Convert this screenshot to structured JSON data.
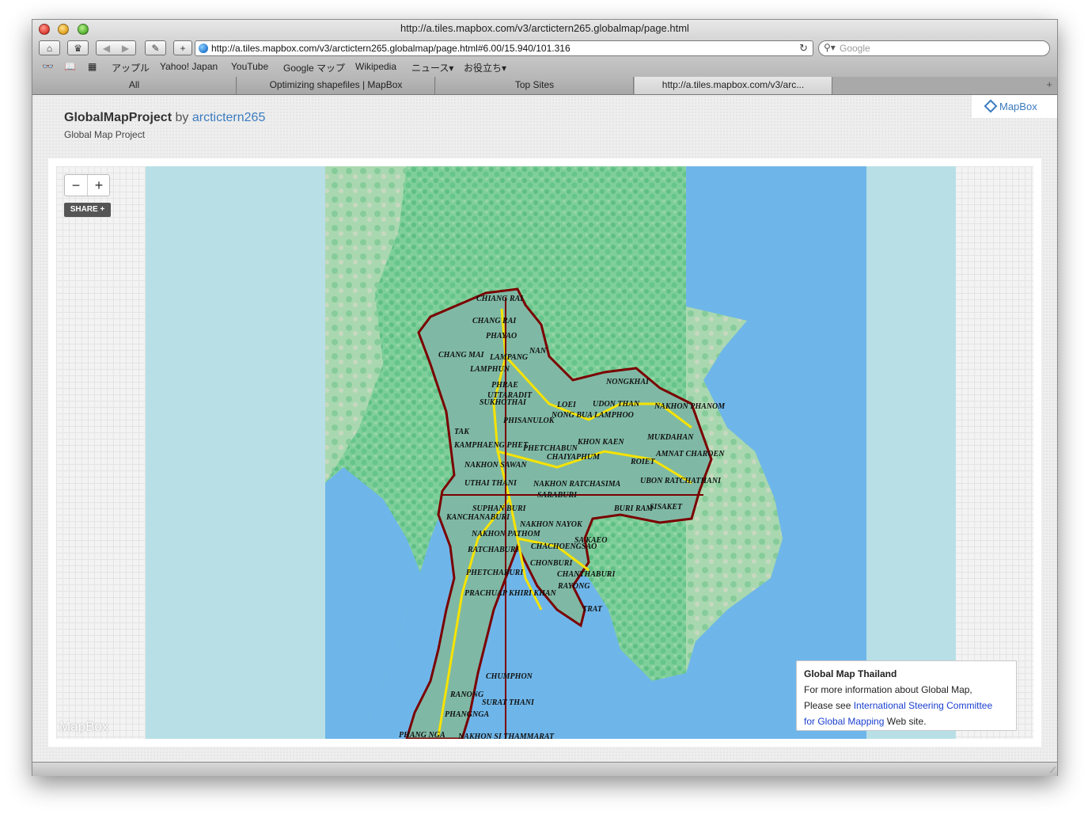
{
  "window": {
    "title": "http://a.tiles.mapbox.com/v3/arctictern265.globalmap/page.html"
  },
  "toolbar": {
    "add_label": "+",
    "url": "http://a.tiles.mapbox.com/v3/arctictern265.globalmap/page.html#6.00/15.940/101.316",
    "search_placeholder": "Google"
  },
  "bookmarks": [
    "アップル",
    "Yahoo! Japan",
    "YouTube",
    "Google マップ",
    "Wikipedia",
    "ニュース▾",
    "お役立ち▾"
  ],
  "tabs": [
    {
      "label": "All"
    },
    {
      "label": "Optimizing shapefiles | MapBox"
    },
    {
      "label": "Top Sites"
    },
    {
      "label": "http://a.tiles.mapbox.com/v3/arc..."
    }
  ],
  "page": {
    "title": "GlobalMapProject",
    "by": "by",
    "author": "arctictern265",
    "subtitle": "Global Map Project",
    "brand": "MapBox"
  },
  "map": {
    "zoom_out": "−",
    "zoom_in": "+",
    "share": "SHARE +",
    "watermark": "MapBox",
    "labels": [
      "CHIANG RAI",
      "CHANG RAI",
      "PHAYAO",
      "NAN",
      "CHANG MAI",
      "LAMPANG",
      "LAMPHUN",
      "PHRAE",
      "UTTARADIT",
      "SUKHOTHAI",
      "PHISANULOK",
      "TAK",
      "KAMPHAENG PHET",
      "PHETCHABUN",
      "CHAIYAPHUM",
      "NAKHON SAWAN",
      "NONGKHAI",
      "LOEI",
      "UDON THAN",
      "NAKHON PHANOM",
      "NONG BUA LAMPHOO",
      "KHON KAEN",
      "MUKDAHAN",
      "ROIET",
      "AMNAT CHAROEN",
      "UBON RATCHATHANI",
      "UTHAI THANI",
      "NAKHON RATCHASIMA",
      "SARABURI",
      "SUPHAN BURI",
      "BURI RAM",
      "SISAKET",
      "KANCHANABURI",
      "NAKHON PATHOM",
      "NAKHON NAYOK",
      "SA KAEO",
      "RATCHABURI",
      "CHACHOENGSAO",
      "CHONBURI",
      "CHANTHABURI",
      "RAYONG",
      "PHETCHABURI",
      "PRACHUAP KHIRI KHAN",
      "TRAT",
      "CHUMPHON",
      "RANONG",
      "SURAT THANI",
      "PHANGNGA",
      "PHANG NGA",
      "NAKHON SI THAMMARAT"
    ],
    "legend": {
      "title": "Global Map Thailand",
      "line1": "For more information about Global Map,",
      "line2_prefix": "Please see ",
      "link1": "International Steering Committee",
      "link2": "for Global Mapping",
      "suffix": " Web site."
    }
  }
}
